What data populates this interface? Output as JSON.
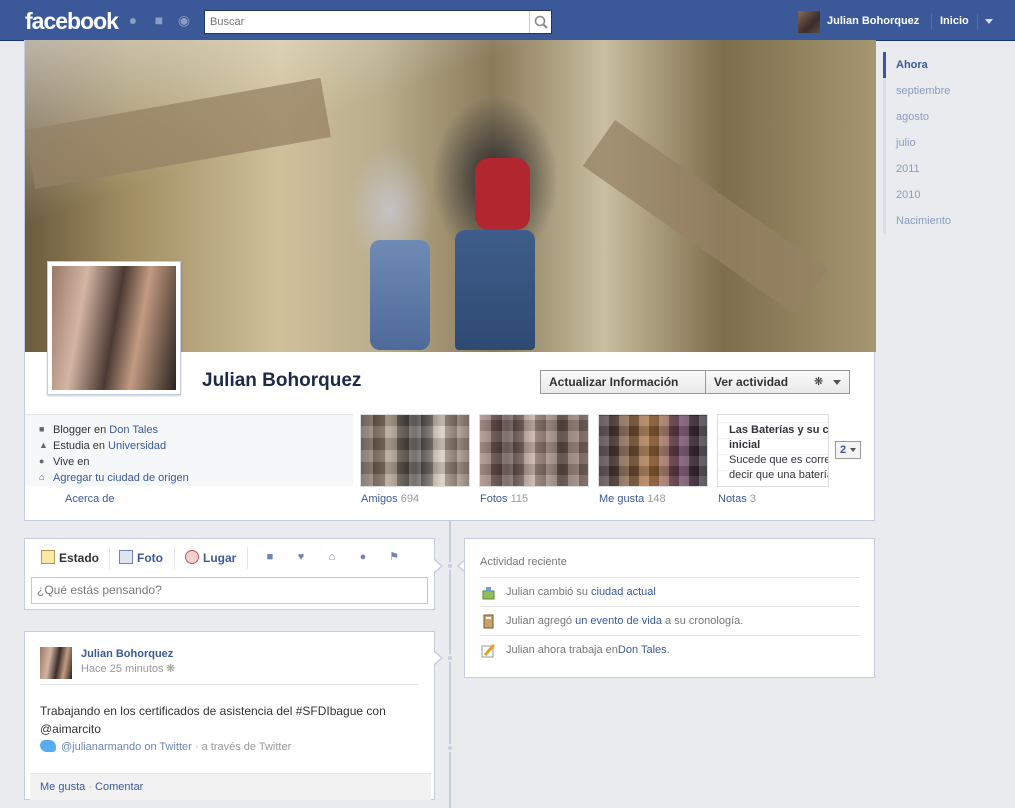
{
  "topbar": {
    "logo": "facebook",
    "search_placeholder": "Buscar",
    "user_name": "Julian Bohorquez",
    "home": "Inicio"
  },
  "timeline_nav": [
    "Ahora",
    "septiembre",
    "agosto",
    "julio",
    "2011",
    "2010",
    "Nacimiento"
  ],
  "profile": {
    "name": "Julian Bohorquez",
    "update_info": "Actualizar Información",
    "view_activity": "Ver actividad",
    "about": {
      "work_prefix": "Blogger en",
      "work_link": "Don Tales",
      "study_prefix": "Estudia en",
      "study_link": "Universidad",
      "lives": "Vive en",
      "add_hometown": "Agregar tu ciudad de origen",
      "label": "Acerca de"
    },
    "apps": {
      "friends_label": "Amigos",
      "friends_count": "694",
      "photos_label": "Fotos",
      "photos_count": "115",
      "likes_label": "Me gusta",
      "likes_count": "148",
      "notes_label": "Notas",
      "notes_count": "3"
    },
    "note_preview": {
      "title_1": "Las Baterías y su c",
      "title_2": "inicial",
      "body_1": "Sucede que es correc",
      "body_2": "decir que una batería"
    },
    "pager": "2"
  },
  "composer": {
    "tab_status": "Estado",
    "tab_photo": "Foto",
    "tab_place": "Lugar",
    "placeholder": "¿Qué estás pensando?"
  },
  "post": {
    "author": "Julian Bohorquez",
    "time": "Hace 25 minutos",
    "text": "Trabajando en los certificados de asistencia del #SFDIbague con @aimarcito",
    "via_handle": "@julianarmando on Twitter",
    "via_suffix": "· a través de Twitter",
    "like": "Me gusta",
    "comment": "Comentar",
    "dot": "·"
  },
  "activity": {
    "title": "Actividad reciente",
    "rows": [
      {
        "prefix": "Julian cambió su",
        "link": "ciudad actual",
        "suffix": ""
      },
      {
        "prefix": "Julian agregó",
        "link": "un evento de vida",
        "suffix": "a su cronología."
      },
      {
        "prefix": "Julian ahora trabaja en",
        "link": "Don Tales",
        "suffix": "."
      }
    ]
  },
  "colors": {
    "brand": "#3b5998",
    "background": "#e9ebee",
    "border": "#c4cde0"
  }
}
